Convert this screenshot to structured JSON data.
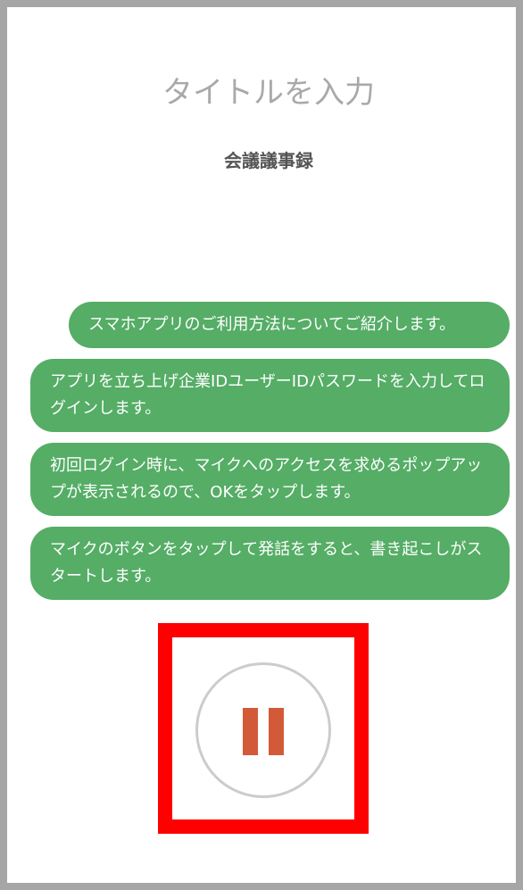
{
  "title_input": {
    "placeholder": "タイトルを入力",
    "value": ""
  },
  "subtitle": "会議議事録",
  "messages": [
    "スマホアプリのご利用方法についてご紹介します。",
    "アプリを立ち上げ企業IDユーザーIDパスワードを入力してログインします。",
    "初回ログイン時に、マイクへのアクセスを求めるポップアップが表示されるので、OKをタップします。",
    "マイクのボタンをタップして発話をすると、書き起こしがスタートします。"
  ],
  "pause_button": {
    "icon": "pause-icon",
    "icon_color": "#d35a38"
  },
  "colors": {
    "bubble": "#55ad66",
    "highlight": "#ff0000",
    "frame": "#a6a6a6"
  }
}
